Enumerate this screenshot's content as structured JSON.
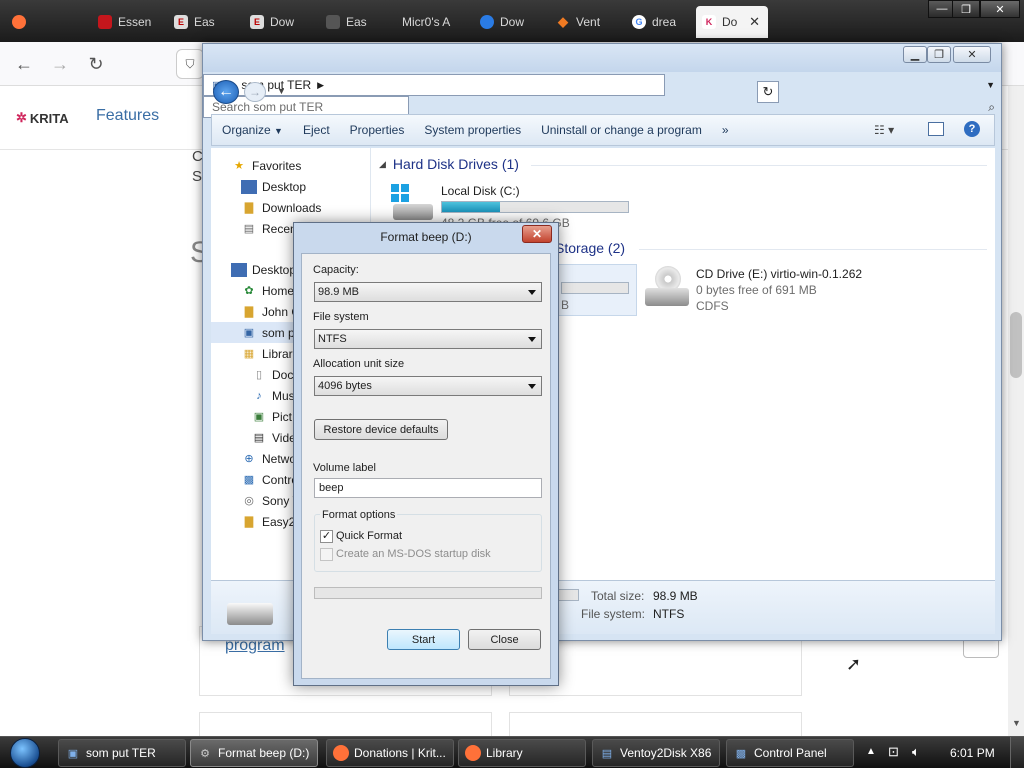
{
  "browser": {
    "tabs": [
      {
        "label": "Essen",
        "icon": "firefox-icon"
      },
      {
        "label": "Essen",
        "icon": "red-bookmark-icon"
      },
      {
        "label": "Eas",
        "icon": "easy2boot-icon"
      },
      {
        "label": "Dow",
        "icon": "easy2boot-icon"
      },
      {
        "label": "Eas",
        "icon": "tab-icon"
      },
      {
        "label": "Micr0's A",
        "icon": "tab-icon"
      },
      {
        "label": "Dow",
        "icon": "blue-icon"
      },
      {
        "label": "Vent",
        "icon": "ventoy-icon"
      },
      {
        "label": "drea",
        "icon": "google-icon"
      },
      {
        "label": "Do",
        "icon": "krita-icon"
      }
    ],
    "win_min": "—",
    "win_max": "❐",
    "win_close": "✕"
  },
  "webpage": {
    "logo": "KRITA",
    "nav_features": "Features",
    "frag_c": "C",
    "frag_s": "S",
    "frag_big_s": "S",
    "program_link": "program"
  },
  "explorer": {
    "address": "som put TER",
    "search_placeholder": "Search som put TER",
    "toolbar": [
      "Organize",
      "Eject",
      "Properties",
      "System properties",
      "Uninstall or change a program",
      "»"
    ],
    "nav": {
      "favorites": "Favorites",
      "desktop": "Desktop",
      "downloads": "Downloads",
      "recent": "Recen",
      "desktop2": "Desktop",
      "home": "Home",
      "john": "John C",
      "computer": "som p",
      "libraries": "Librari",
      "documents": "Doc",
      "music": "Mus",
      "pictures": "Pict",
      "videos": "Vide",
      "network": "Netwo",
      "control": "Contro",
      "sony": "Sony V",
      "easy2": "Easy2"
    },
    "groups": {
      "hdd": "Hard Disk Drives (1)",
      "removable": "Storage (2)"
    },
    "local_disk": {
      "name": "Local Disk (C:)",
      "free": "48.2 GB free of 69.6 GB",
      "used_fraction": 0.31
    },
    "cd_drive": {
      "name": "CD Drive (E:) virtio-win-0.1.262",
      "free": "0 bytes free of 691 MB",
      "fs": "CDFS"
    },
    "removable_frag": "B",
    "details": {
      "total_label": "Total size:",
      "total_value": "98.9 MB",
      "fs_label": "File system:",
      "fs_value": "NTFS"
    }
  },
  "format_dialog": {
    "title": "Format beep (D:)",
    "close": "✕",
    "capacity_label": "Capacity:",
    "capacity_value": "98.9 MB",
    "fs_label": "File system",
    "fs_value": "NTFS",
    "alloc_label": "Allocation unit size",
    "alloc_value": "4096 bytes",
    "restore_button": "Restore device defaults",
    "volume_label": "Volume label",
    "volume_value": "beep",
    "options_label": "Format options",
    "quick_format": "Quick Format",
    "quick_format_checked": true,
    "msdos": "Create an MS-DOS startup disk",
    "msdos_checked": false,
    "progress": 0,
    "start": "Start",
    "close_button": "Close"
  },
  "taskbar": {
    "items": [
      {
        "label": "som put TER",
        "icon": "computer-icon"
      },
      {
        "label": "Format beep (D:)",
        "icon": "format-icon"
      },
      {
        "label": "Donations | Krit...",
        "icon": "firefox-icon"
      },
      {
        "label": "Library",
        "icon": "firefox-icon"
      },
      {
        "label": "Ventoy2Disk  X86",
        "icon": "ventoy-icon"
      },
      {
        "label": "Control Panel",
        "icon": "control-panel-icon"
      }
    ],
    "time": "6:01 PM"
  }
}
